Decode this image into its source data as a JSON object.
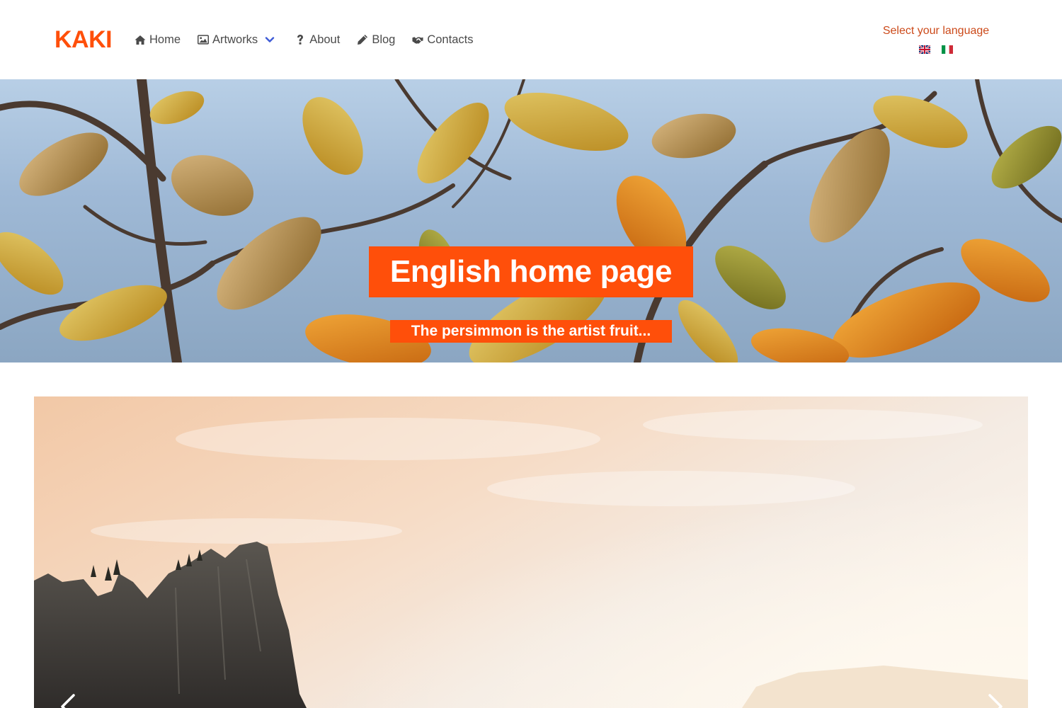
{
  "brand": {
    "name": "KAKI",
    "color": "#ff4f0a"
  },
  "nav": {
    "items": [
      {
        "label": "Home",
        "icon": "home-icon"
      },
      {
        "label": "Artworks",
        "icon": "image-icon",
        "dropdown": true
      },
      {
        "label": "About",
        "icon": "question-icon"
      },
      {
        "label": "Blog",
        "icon": "pencil-icon"
      },
      {
        "label": "Contacts",
        "icon": "handshake-icon"
      }
    ]
  },
  "language": {
    "label": "Select your language",
    "options": [
      {
        "code": "en",
        "icon": "uk-flag-icon"
      },
      {
        "code": "it",
        "icon": "italy-flag-icon"
      }
    ]
  },
  "hero": {
    "title": "English home page",
    "subtitle": "The persimmon is the artist fruit..."
  },
  "carousel": {
    "prev_icon": "chevron-left-icon",
    "next_icon": "chevron-right-icon"
  },
  "colors": {
    "accent": "#ff4f0a",
    "nav_text": "#4a4a4a",
    "language_label": "#cc4a1a",
    "dropdown_chevron": "#3e5bd6"
  }
}
